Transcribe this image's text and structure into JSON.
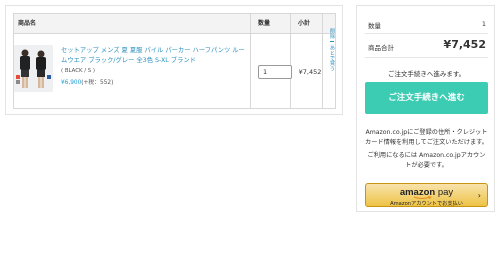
{
  "cart": {
    "headers": {
      "product": "商品名",
      "quantity": "数量",
      "subtotal": "小計"
    },
    "items": [
      {
        "title": "セットアップ メンズ 夏 夏服 パイル パーカー ハーフパンツ ルームウエア ブラック/グレー 全3色 S-XL ブランド",
        "variant": "( BLACK / S )",
        "price": "¥6,900",
        "tax_note": "(+税：552)",
        "quantity": "1",
        "subtotal": "¥7,452",
        "delete_label": "削除",
        "save_later_label": "あとで買う"
      }
    ]
  },
  "summary": {
    "quantity_label": "数量",
    "quantity_value": "1",
    "total_label": "商品合計",
    "total_value": "¥7,452",
    "proceed_hint": "ご注文手続きへ進みます。",
    "proceed_button": "ご注文手続きへ進む",
    "amazon_note_1": "Amazon.co.jpにご登録の住所・クレジットカード情報を利用してご注文いただけます。",
    "amazon_note_2": "ご利用になるには Amazon.co.jpアカウントが必要です。",
    "amazon_pay": {
      "logo_amazon": "amazon",
      "logo_pay": "pay",
      "sub_label": "Amazonアカウントでお支払い",
      "arrow_icon": "chevron-right-icon"
    }
  },
  "colors": {
    "link_blue": "#2a8fbd",
    "proceed_teal": "#3ccbb3",
    "amazon_yellow": "#eec345"
  }
}
